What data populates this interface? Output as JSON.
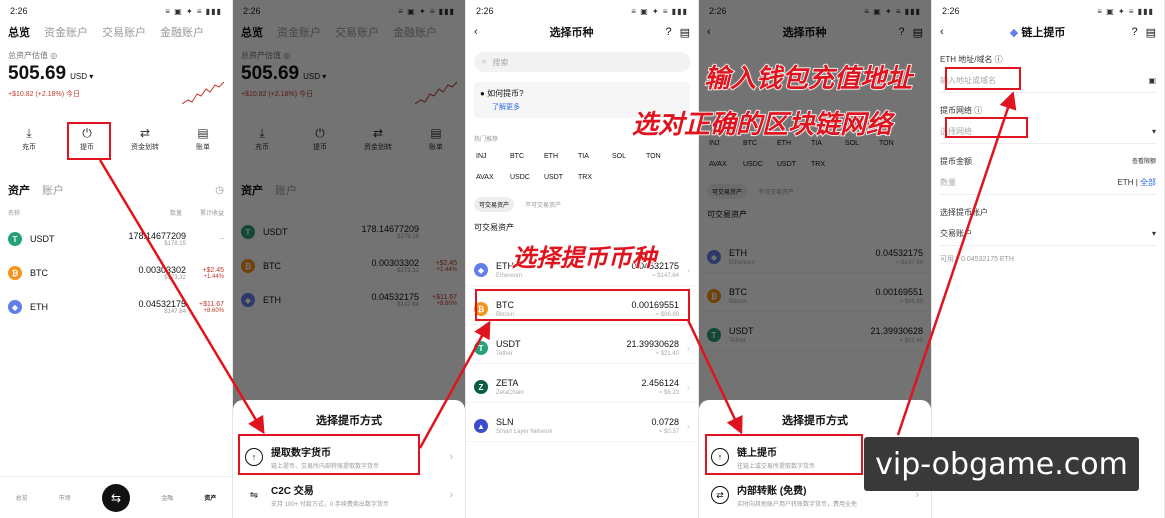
{
  "status_time": "2:26",
  "status_icons": "≡ ▣ ✦ ≡ ▮▮▮",
  "p1": {
    "tabs": [
      "总览",
      "资金账户",
      "交易账户",
      "金融账户"
    ],
    "total_label": "总资产估值 ◎",
    "total": "505.69",
    "currency": "USD ▾",
    "change": "+$10.82 (+2.18%) 今日",
    "actions": [
      "充币",
      "提币",
      "资金划转",
      "账单"
    ],
    "section_tabs": [
      "资产",
      "账户"
    ],
    "col_headers": [
      "名称",
      "数量",
      "累计收益"
    ],
    "assets": [
      {
        "sym": "USDT",
        "amount": "178.14677209",
        "usd": "$178.15",
        "pnl": "--",
        "pnl_pct": ""
      },
      {
        "sym": "BTC",
        "amount": "0.00303302",
        "usd": "$173.32",
        "pnl": "+$2.45",
        "pnl_pct": "+1.44%"
      },
      {
        "sym": "ETH",
        "amount": "0.04532175",
        "usd": "$147.64",
        "pnl": "+$11.67",
        "pnl_pct": "+8.60%"
      }
    ],
    "nav": [
      "总览",
      "市场",
      "交易",
      "金融",
      "资产"
    ],
    "nav_mid": "⇆"
  },
  "p2": {
    "sheet_title": "选择提币方式",
    "opt1_title": "提取数字货币",
    "opt1_desc": "链上提币、交易所内部转账提取数字货币",
    "opt2_title": "C2C 交易",
    "opt2_desc": "支持 100+ 付款方式，0 手续费卖出数字货币"
  },
  "p3": {
    "title": "选择币种",
    "search_placeholder": "搜索",
    "tip": "如何提币?",
    "tip_link": "了解更多",
    "hot_label": "热门推荐",
    "chips": [
      "INJ",
      "BTC",
      "ETH",
      "TIA",
      "SOL",
      "TON",
      "AVAX",
      "USDC",
      "USDT",
      "TRX"
    ],
    "subtabs": [
      "可交易资产",
      "不可交易资产"
    ],
    "list_header": "可交易资产",
    "coins": [
      {
        "sym": "ETH",
        "name": "Ethereum",
        "amount": "0.04532175",
        "usd": "≈ $147.64"
      },
      {
        "sym": "BTC",
        "name": "Bitcoin",
        "amount": "0.00169551",
        "usd": "≈ $96.89"
      },
      {
        "sym": "USDT",
        "name": "Tether",
        "amount": "21.39930628",
        "usd": "≈ $21.40"
      },
      {
        "sym": "ZETA",
        "name": "ZetaChain",
        "amount": "2.456124",
        "usd": "≈ $6.23"
      },
      {
        "sym": "SLN",
        "name": "Smart Layer Network",
        "amount": "0.0728",
        "usd": "≈ $0.37"
      }
    ]
  },
  "p4": {
    "sheet_title": "选择提币方式",
    "opt1_title": "链上提币",
    "opt1_desc": "往链上或交易所提取数字货币",
    "opt2_title": "内部转账 (免费)",
    "opt2_desc": "实时向其他账户用户转账数字货币，费用全免"
  },
  "p5": {
    "title": "链上提币",
    "addr_label": "ETH 地址/域名 ⓘ",
    "addr_placeholder": "输入地址或域名",
    "network_label": "提币网络 ⓘ",
    "network_placeholder": "选择网络",
    "amount_label": "提币金额",
    "limit_link": "查看限额",
    "amount_placeholder": "数量",
    "unit": "ETH",
    "all": "全部",
    "account_label": "选择提币账户",
    "account_value": "交易账户",
    "available": "可用：0.04532175 ETH"
  },
  "callouts": {
    "c1": "选择提币币种",
    "c2": "输入钱包充值地址",
    "c3": "选对正确的区块链网络"
  },
  "watermark": "vip-obgame.com",
  "colors": {
    "annotation": "#e0141e",
    "eth": "#627eea",
    "btc": "#f7931a",
    "usdt": "#26a17b",
    "zeta": "#0b5d3f",
    "sln": "#3b4cca"
  }
}
